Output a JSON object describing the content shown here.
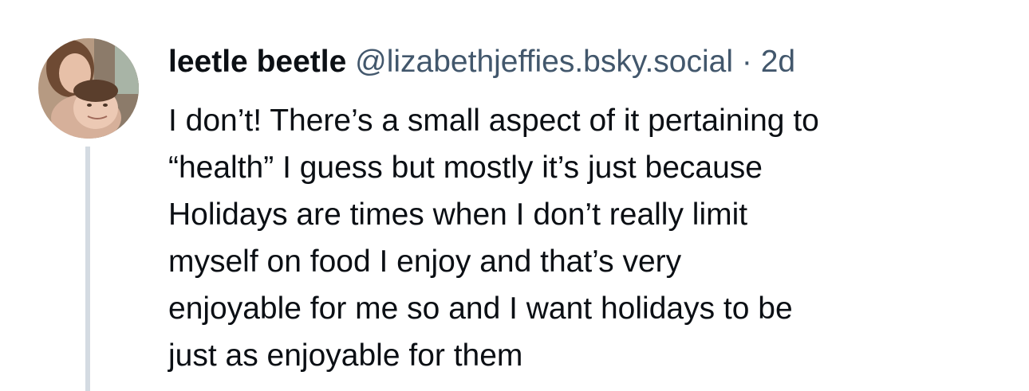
{
  "post": {
    "author": {
      "display_name": "leetle beetle",
      "handle": "@lizabethjeffies.bsky.social"
    },
    "separator": "·",
    "timestamp": "2d",
    "text": "I don’t! There’s a small aspect of it pertaining to\n“health” I guess but mostly it’s just because\nHolidays are times when I don’t really limit\nmyself on food I enjoy and that’s very\nenjoyable for me so and I want holidays to be\njust as enjoyable for them"
  },
  "colors": {
    "text_primary": "#0b0f14",
    "text_secondary": "#42576c",
    "thread_line": "#d4dbe2",
    "background": "#ffffff"
  }
}
